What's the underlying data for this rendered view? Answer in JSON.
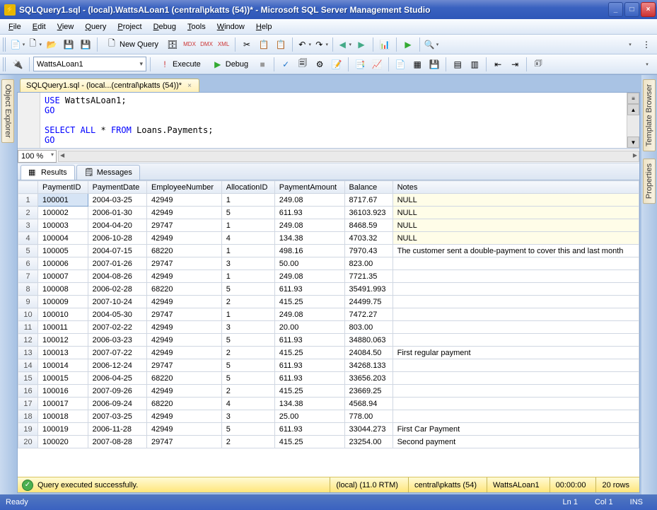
{
  "window": {
    "title": "SQLQuery1.sql - (local).WattsALoan1 (central\\pkatts (54))* - Microsoft SQL Server Management Studio"
  },
  "menu": {
    "file": "File",
    "edit": "Edit",
    "view": "View",
    "query": "Query",
    "project": "Project",
    "debug": "Debug",
    "tools": "Tools",
    "window": "Window",
    "help": "Help"
  },
  "toolbar": {
    "new_query": "New Query",
    "db_combo": "WattsALoan1",
    "execute": "Execute",
    "debug": "Debug"
  },
  "sidebar": {
    "left": "Object Explorer",
    "right_top": "Template Browser",
    "right_bottom": "Properties"
  },
  "doc_tab": "SQLQuery1.sql - (local...(central\\pkatts (54))*",
  "code": {
    "l1a": "USE",
    "l1b": " WattsALoan1;",
    "l2": "GO",
    "l3a": "SELECT",
    "l3b": " ALL ",
    "l3c": "*",
    "l3d": " FROM",
    "l3e": " Loans.Payments;",
    "l4": "GO"
  },
  "zoom": "100 %",
  "result_tabs": {
    "results": "Results",
    "messages": "Messages"
  },
  "columns": [
    "PaymentID",
    "PaymentDate",
    "EmployeeNumber",
    "AllocationID",
    "PaymentAmount",
    "Balance",
    "Notes"
  ],
  "rows": [
    {
      "n": 1,
      "c": [
        "100001",
        "2004-03-25",
        "42949",
        "1",
        "249.08",
        "8717.67",
        "NULL"
      ],
      "null": true
    },
    {
      "n": 2,
      "c": [
        "100002",
        "2006-01-30",
        "42949",
        "5",
        "611.93",
        "36103.923",
        "NULL"
      ],
      "null": true
    },
    {
      "n": 3,
      "c": [
        "100003",
        "2004-04-20",
        "29747",
        "1",
        "249.08",
        "8468.59",
        "NULL"
      ],
      "null": true
    },
    {
      "n": 4,
      "c": [
        "100004",
        "2006-10-28",
        "42949",
        "4",
        "134.38",
        "4703.32",
        "NULL"
      ],
      "null": true
    },
    {
      "n": 5,
      "c": [
        "100005",
        "2004-07-15",
        "68220",
        "1",
        "498.16",
        "7970.43",
        "The customer sent a double-payment to cover this and last month"
      ],
      "null": false
    },
    {
      "n": 6,
      "c": [
        "100006",
        "2007-01-26",
        "29747",
        "3",
        "50.00",
        "823.00",
        ""
      ],
      "null": false
    },
    {
      "n": 7,
      "c": [
        "100007",
        "2004-08-26",
        "42949",
        "1",
        "249.08",
        "7721.35",
        ""
      ],
      "null": false
    },
    {
      "n": 8,
      "c": [
        "100008",
        "2006-02-28",
        "68220",
        "5",
        "611.93",
        "35491.993",
        ""
      ],
      "null": false
    },
    {
      "n": 9,
      "c": [
        "100009",
        "2007-10-24",
        "42949",
        "2",
        "415.25",
        "24499.75",
        ""
      ],
      "null": false
    },
    {
      "n": 10,
      "c": [
        "100010",
        "2004-05-30",
        "29747",
        "1",
        "249.08",
        "7472.27",
        ""
      ],
      "null": false
    },
    {
      "n": 11,
      "c": [
        "100011",
        "2007-02-22",
        "42949",
        "3",
        "20.00",
        "803.00",
        ""
      ],
      "null": false
    },
    {
      "n": 12,
      "c": [
        "100012",
        "2006-03-23",
        "42949",
        "5",
        "611.93",
        "34880.063",
        ""
      ],
      "null": false
    },
    {
      "n": 13,
      "c": [
        "100013",
        "2007-07-22",
        "42949",
        "2",
        "415.25",
        "24084.50",
        "First regular payment"
      ],
      "null": false
    },
    {
      "n": 14,
      "c": [
        "100014",
        "2006-12-24",
        "29747",
        "5",
        "611.93",
        "34268.133",
        ""
      ],
      "null": false
    },
    {
      "n": 15,
      "c": [
        "100015",
        "2006-04-25",
        "68220",
        "5",
        "611.93",
        "33656.203",
        ""
      ],
      "null": false
    },
    {
      "n": 16,
      "c": [
        "100016",
        "2007-09-26",
        "42949",
        "2",
        "415.25",
        "23669.25",
        ""
      ],
      "null": false
    },
    {
      "n": 17,
      "c": [
        "100017",
        "2006-09-24",
        "68220",
        "4",
        "134.38",
        "4568.94",
        ""
      ],
      "null": false
    },
    {
      "n": 18,
      "c": [
        "100018",
        "2007-03-25",
        "42949",
        "3",
        "25.00",
        "778.00",
        ""
      ],
      "null": false
    },
    {
      "n": 19,
      "c": [
        "100019",
        "2006-11-28",
        "42949",
        "5",
        "611.93",
        "33044.273",
        "First Car Payment"
      ],
      "null": false
    },
    {
      "n": 20,
      "c": [
        "100020",
        "2007-08-28",
        "29747",
        "2",
        "415.25",
        "23254.00",
        "Second payment"
      ],
      "null": false
    }
  ],
  "status_yellow": {
    "msg": "Query executed successfully.",
    "server": "(local) (11.0 RTM)",
    "user": "central\\pkatts (54)",
    "db": "WattsALoan1",
    "time": "00:00:00",
    "rows": "20 rows"
  },
  "status_blue": {
    "ready": "Ready",
    "ln": "Ln 1",
    "col": "Col 1",
    "ins": "INS"
  }
}
